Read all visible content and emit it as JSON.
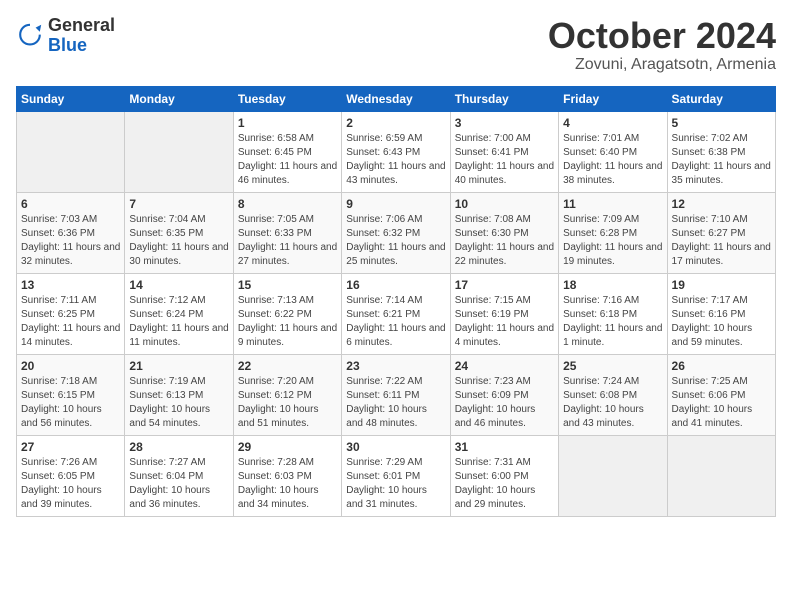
{
  "header": {
    "logo_general": "General",
    "logo_blue": "Blue",
    "month": "October 2024",
    "location": "Zovuni, Aragatsotn, Armenia"
  },
  "weekdays": [
    "Sunday",
    "Monday",
    "Tuesday",
    "Wednesday",
    "Thursday",
    "Friday",
    "Saturday"
  ],
  "weeks": [
    [
      {
        "day": "",
        "empty": true
      },
      {
        "day": "",
        "empty": true
      },
      {
        "day": "1",
        "sunrise": "Sunrise: 6:58 AM",
        "sunset": "Sunset: 6:45 PM",
        "daylight": "Daylight: 11 hours and 46 minutes."
      },
      {
        "day": "2",
        "sunrise": "Sunrise: 6:59 AM",
        "sunset": "Sunset: 6:43 PM",
        "daylight": "Daylight: 11 hours and 43 minutes."
      },
      {
        "day": "3",
        "sunrise": "Sunrise: 7:00 AM",
        "sunset": "Sunset: 6:41 PM",
        "daylight": "Daylight: 11 hours and 40 minutes."
      },
      {
        "day": "4",
        "sunrise": "Sunrise: 7:01 AM",
        "sunset": "Sunset: 6:40 PM",
        "daylight": "Daylight: 11 hours and 38 minutes."
      },
      {
        "day": "5",
        "sunrise": "Sunrise: 7:02 AM",
        "sunset": "Sunset: 6:38 PM",
        "daylight": "Daylight: 11 hours and 35 minutes."
      }
    ],
    [
      {
        "day": "6",
        "sunrise": "Sunrise: 7:03 AM",
        "sunset": "Sunset: 6:36 PM",
        "daylight": "Daylight: 11 hours and 32 minutes."
      },
      {
        "day": "7",
        "sunrise": "Sunrise: 7:04 AM",
        "sunset": "Sunset: 6:35 PM",
        "daylight": "Daylight: 11 hours and 30 minutes."
      },
      {
        "day": "8",
        "sunrise": "Sunrise: 7:05 AM",
        "sunset": "Sunset: 6:33 PM",
        "daylight": "Daylight: 11 hours and 27 minutes."
      },
      {
        "day": "9",
        "sunrise": "Sunrise: 7:06 AM",
        "sunset": "Sunset: 6:32 PM",
        "daylight": "Daylight: 11 hours and 25 minutes."
      },
      {
        "day": "10",
        "sunrise": "Sunrise: 7:08 AM",
        "sunset": "Sunset: 6:30 PM",
        "daylight": "Daylight: 11 hours and 22 minutes."
      },
      {
        "day": "11",
        "sunrise": "Sunrise: 7:09 AM",
        "sunset": "Sunset: 6:28 PM",
        "daylight": "Daylight: 11 hours and 19 minutes."
      },
      {
        "day": "12",
        "sunrise": "Sunrise: 7:10 AM",
        "sunset": "Sunset: 6:27 PM",
        "daylight": "Daylight: 11 hours and 17 minutes."
      }
    ],
    [
      {
        "day": "13",
        "sunrise": "Sunrise: 7:11 AM",
        "sunset": "Sunset: 6:25 PM",
        "daylight": "Daylight: 11 hours and 14 minutes."
      },
      {
        "day": "14",
        "sunrise": "Sunrise: 7:12 AM",
        "sunset": "Sunset: 6:24 PM",
        "daylight": "Daylight: 11 hours and 11 minutes."
      },
      {
        "day": "15",
        "sunrise": "Sunrise: 7:13 AM",
        "sunset": "Sunset: 6:22 PM",
        "daylight": "Daylight: 11 hours and 9 minutes."
      },
      {
        "day": "16",
        "sunrise": "Sunrise: 7:14 AM",
        "sunset": "Sunset: 6:21 PM",
        "daylight": "Daylight: 11 hours and 6 minutes."
      },
      {
        "day": "17",
        "sunrise": "Sunrise: 7:15 AM",
        "sunset": "Sunset: 6:19 PM",
        "daylight": "Daylight: 11 hours and 4 minutes."
      },
      {
        "day": "18",
        "sunrise": "Sunrise: 7:16 AM",
        "sunset": "Sunset: 6:18 PM",
        "daylight": "Daylight: 11 hours and 1 minute."
      },
      {
        "day": "19",
        "sunrise": "Sunrise: 7:17 AM",
        "sunset": "Sunset: 6:16 PM",
        "daylight": "Daylight: 10 hours and 59 minutes."
      }
    ],
    [
      {
        "day": "20",
        "sunrise": "Sunrise: 7:18 AM",
        "sunset": "Sunset: 6:15 PM",
        "daylight": "Daylight: 10 hours and 56 minutes."
      },
      {
        "day": "21",
        "sunrise": "Sunrise: 7:19 AM",
        "sunset": "Sunset: 6:13 PM",
        "daylight": "Daylight: 10 hours and 54 minutes."
      },
      {
        "day": "22",
        "sunrise": "Sunrise: 7:20 AM",
        "sunset": "Sunset: 6:12 PM",
        "daylight": "Daylight: 10 hours and 51 minutes."
      },
      {
        "day": "23",
        "sunrise": "Sunrise: 7:22 AM",
        "sunset": "Sunset: 6:11 PM",
        "daylight": "Daylight: 10 hours and 48 minutes."
      },
      {
        "day": "24",
        "sunrise": "Sunrise: 7:23 AM",
        "sunset": "Sunset: 6:09 PM",
        "daylight": "Daylight: 10 hours and 46 minutes."
      },
      {
        "day": "25",
        "sunrise": "Sunrise: 7:24 AM",
        "sunset": "Sunset: 6:08 PM",
        "daylight": "Daylight: 10 hours and 43 minutes."
      },
      {
        "day": "26",
        "sunrise": "Sunrise: 7:25 AM",
        "sunset": "Sunset: 6:06 PM",
        "daylight": "Daylight: 10 hours and 41 minutes."
      }
    ],
    [
      {
        "day": "27",
        "sunrise": "Sunrise: 7:26 AM",
        "sunset": "Sunset: 6:05 PM",
        "daylight": "Daylight: 10 hours and 39 minutes."
      },
      {
        "day": "28",
        "sunrise": "Sunrise: 7:27 AM",
        "sunset": "Sunset: 6:04 PM",
        "daylight": "Daylight: 10 hours and 36 minutes."
      },
      {
        "day": "29",
        "sunrise": "Sunrise: 7:28 AM",
        "sunset": "Sunset: 6:03 PM",
        "daylight": "Daylight: 10 hours and 34 minutes."
      },
      {
        "day": "30",
        "sunrise": "Sunrise: 7:29 AM",
        "sunset": "Sunset: 6:01 PM",
        "daylight": "Daylight: 10 hours and 31 minutes."
      },
      {
        "day": "31",
        "sunrise": "Sunrise: 7:31 AM",
        "sunset": "Sunset: 6:00 PM",
        "daylight": "Daylight: 10 hours and 29 minutes."
      },
      {
        "day": "",
        "empty": true
      },
      {
        "day": "",
        "empty": true
      }
    ]
  ]
}
